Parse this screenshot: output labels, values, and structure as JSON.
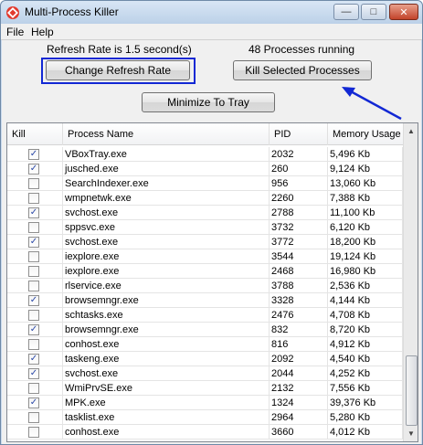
{
  "window": {
    "title": "Multi-Process Killer",
    "icons": {
      "app": "mpk-app-icon",
      "minimize": "minimize-icon",
      "maximize": "maximize-icon",
      "close": "close-icon"
    },
    "controls": {
      "minimize": "—",
      "maximize": "□",
      "close": "✕"
    }
  },
  "menu": {
    "file": "File",
    "help": "Help"
  },
  "status": {
    "refresh_rate": "Refresh Rate is 1.5 second(s)",
    "processes_running": "48 Processes running"
  },
  "buttons": {
    "change_refresh": "Change Refresh Rate",
    "kill_selected": "Kill Selected Processes",
    "minimize_tray": "Minimize To Tray"
  },
  "annotations": {
    "highlight_color": "#1228d4",
    "arrow_color": "#1228d4"
  },
  "table": {
    "columns": [
      "Kill",
      "Process Name",
      "PID",
      "Memory Usage"
    ],
    "rows": [
      {
        "kill": true,
        "name": "VBoxTray.exe",
        "pid": "2032",
        "mem": "5,496 Kb"
      },
      {
        "kill": true,
        "name": "jusched.exe",
        "pid": "260",
        "mem": "9,124 Kb"
      },
      {
        "kill": false,
        "name": "SearchIndexer.exe",
        "pid": "956",
        "mem": "13,060 Kb"
      },
      {
        "kill": false,
        "name": "wmpnetwk.exe",
        "pid": "2260",
        "mem": "7,388 Kb"
      },
      {
        "kill": true,
        "name": "svchost.exe",
        "pid": "2788",
        "mem": "11,100 Kb"
      },
      {
        "kill": false,
        "name": "sppsvc.exe",
        "pid": "3732",
        "mem": "6,120 Kb"
      },
      {
        "kill": true,
        "name": "svchost.exe",
        "pid": "3772",
        "mem": "18,200 Kb"
      },
      {
        "kill": false,
        "name": "iexplore.exe",
        "pid": "3544",
        "mem": "19,124 Kb"
      },
      {
        "kill": false,
        "name": "iexplore.exe",
        "pid": "2468",
        "mem": "16,980 Kb"
      },
      {
        "kill": false,
        "name": "rlservice.exe",
        "pid": "3788",
        "mem": "2,536 Kb"
      },
      {
        "kill": true,
        "name": "browsemngr.exe",
        "pid": "3328",
        "mem": "4,144 Kb"
      },
      {
        "kill": false,
        "name": "schtasks.exe",
        "pid": "2476",
        "mem": "4,708 Kb"
      },
      {
        "kill": true,
        "name": "browsemngr.exe",
        "pid": "832",
        "mem": "8,720 Kb"
      },
      {
        "kill": false,
        "name": "conhost.exe",
        "pid": "816",
        "mem": "4,912 Kb"
      },
      {
        "kill": true,
        "name": "taskeng.exe",
        "pid": "2092",
        "mem": "4,540 Kb"
      },
      {
        "kill": true,
        "name": "svchost.exe",
        "pid": "2044",
        "mem": "4,252 Kb"
      },
      {
        "kill": false,
        "name": "WmiPrvSE.exe",
        "pid": "2132",
        "mem": "7,556 Kb"
      },
      {
        "kill": true,
        "name": "MPK.exe",
        "pid": "1324",
        "mem": "39,376 Kb"
      },
      {
        "kill": false,
        "name": "tasklist.exe",
        "pid": "2964",
        "mem": "5,280 Kb"
      },
      {
        "kill": false,
        "name": "conhost.exe",
        "pid": "3660",
        "mem": "4,012 Kb"
      }
    ]
  },
  "scrollbar": {
    "up": "▲",
    "down": "▼"
  }
}
